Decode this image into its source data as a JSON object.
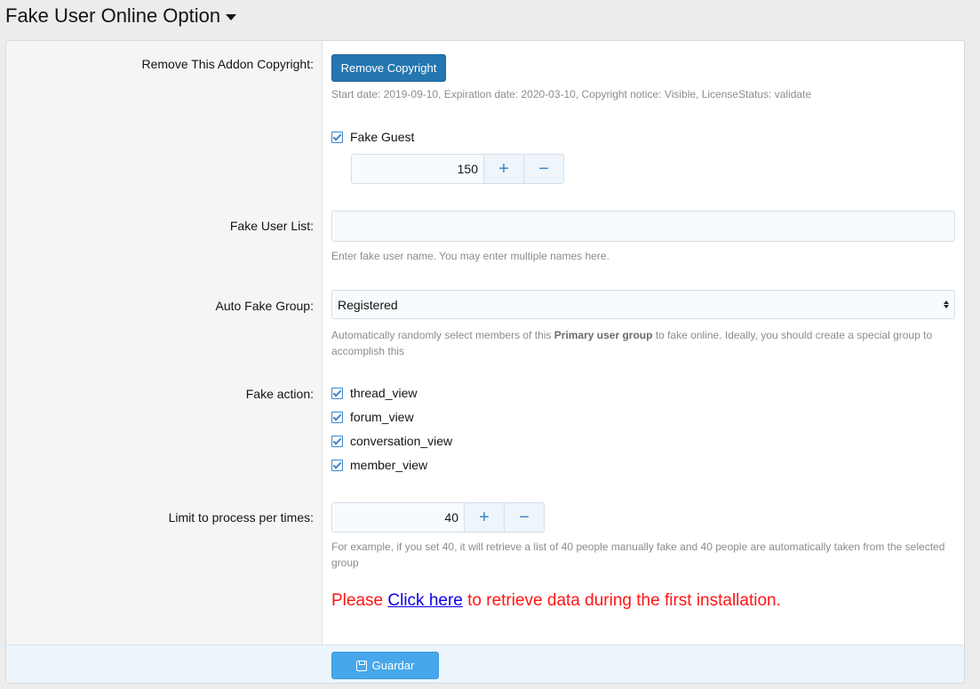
{
  "page": {
    "title": "Fake User Online Option"
  },
  "copyright": {
    "label": "Remove This Addon Copyright:",
    "button": "Remove Copyright",
    "info": "Start date: 2019-09-10, Expiration date: 2020-03-10, Copyright notice: Visible, LicenseStatus: validate"
  },
  "fake_guest": {
    "label": "Fake Guest",
    "checked": true,
    "value": "150",
    "plus": "+",
    "minus": "−"
  },
  "fake_user_list": {
    "label": "Fake User List:",
    "value": "",
    "hint": "Enter fake user name. You may enter multiple names here."
  },
  "auto_fake_group": {
    "label": "Auto Fake Group:",
    "selected": "Registered",
    "hint_before": "Automatically randomly select members of this ",
    "hint_bold": "Primary user group",
    "hint_after": " to fake online. Ideally, you should create a special group to accomplish this"
  },
  "fake_action": {
    "label": "Fake action:",
    "options": [
      {
        "label": "thread_view",
        "checked": true
      },
      {
        "label": "forum_view",
        "checked": true
      },
      {
        "label": "conversation_view",
        "checked": true
      },
      {
        "label": "member_view",
        "checked": true
      }
    ]
  },
  "limit": {
    "label": "Limit to process per times:",
    "value": "40",
    "plus": "+",
    "minus": "−",
    "hint": "For example, if you set 40, it will retrieve a list of 40 people manually fake and 40 people are automatically taken from the selected group"
  },
  "notice": {
    "before": "Please ",
    "link": "Click here",
    "after": " to retrieve data during the first installation."
  },
  "footer": {
    "save_label": "Guardar"
  },
  "colors": {
    "primary_button": "#2577b1",
    "save_button": "#47a7eb",
    "notice_text": "#ff1414",
    "link": "#0b00e8",
    "checkbox": "#3c86c7"
  }
}
